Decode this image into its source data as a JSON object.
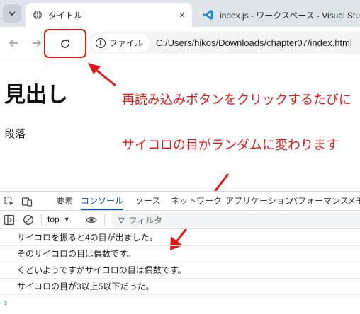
{
  "browser": {
    "tabs": [
      {
        "title": "タイトル",
        "icon": "globe-icon",
        "active": true
      },
      {
        "title": "index.js - ワークスペース - Visual Studio Code",
        "icon": "vscode-icon",
        "active": false
      }
    ],
    "close_glyph": "×",
    "address": {
      "chip_label": "ファイル",
      "url": "C:/Users/hikos/Downloads/chapter07/index.html"
    }
  },
  "page": {
    "heading": "見出し",
    "paragraph": "段落"
  },
  "annotations": {
    "line1": "再読み込みボタンをクリックするたびに",
    "line2": "サイコロの目がランダムに変わります",
    "color": "#e01919"
  },
  "devtools": {
    "tabs": [
      "要素",
      "コンソール",
      "ソース",
      "ネットワーク",
      "アプリケーション",
      "パフォーマンス",
      "メモリ"
    ],
    "active_tab": "コンソール",
    "context": "top",
    "filter_placeholder": "フィルタ",
    "console_logs": [
      "サイコロを振ると4の目が出ました。",
      "そのサイコロの目は偶数です。",
      "くどいようですがサイコロの目は偶数です。",
      "サイコロの目が3以上5以下だった。"
    ],
    "prompt_glyph": "›"
  }
}
